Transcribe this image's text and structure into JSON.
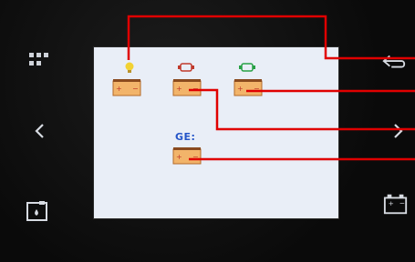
{
  "screen": {
    "ge_label": "GE:"
  },
  "left_controls": [
    {
      "icon": "menu-grid-icon"
    },
    {
      "icon": "chevron-left-icon"
    },
    {
      "icon": "fuel-tank-icon"
    }
  ],
  "right_controls": [
    {
      "icon": "back-arrow-icon"
    },
    {
      "icon": "chevron-right-icon"
    },
    {
      "icon": "battery-icon"
    }
  ],
  "batteries": [
    {
      "name": "battery-light",
      "indicator": "lightbulb-icon",
      "indicator_color": "#f2d233"
    },
    {
      "name": "battery-engine-1",
      "indicator": "engine-icon",
      "indicator_color": "#c0392b"
    },
    {
      "name": "battery-engine-2",
      "indicator": "engine-icon",
      "indicator_color": "#27a045"
    },
    {
      "name": "battery-generator",
      "indicator": "ge-text",
      "indicator_color": "#2454c8"
    }
  ],
  "colors": {
    "callout_line": "#e00000",
    "battery_body": "#f2b46a",
    "battery_cap": "#8a4a1e",
    "screen_bg": "#e9eef7"
  }
}
